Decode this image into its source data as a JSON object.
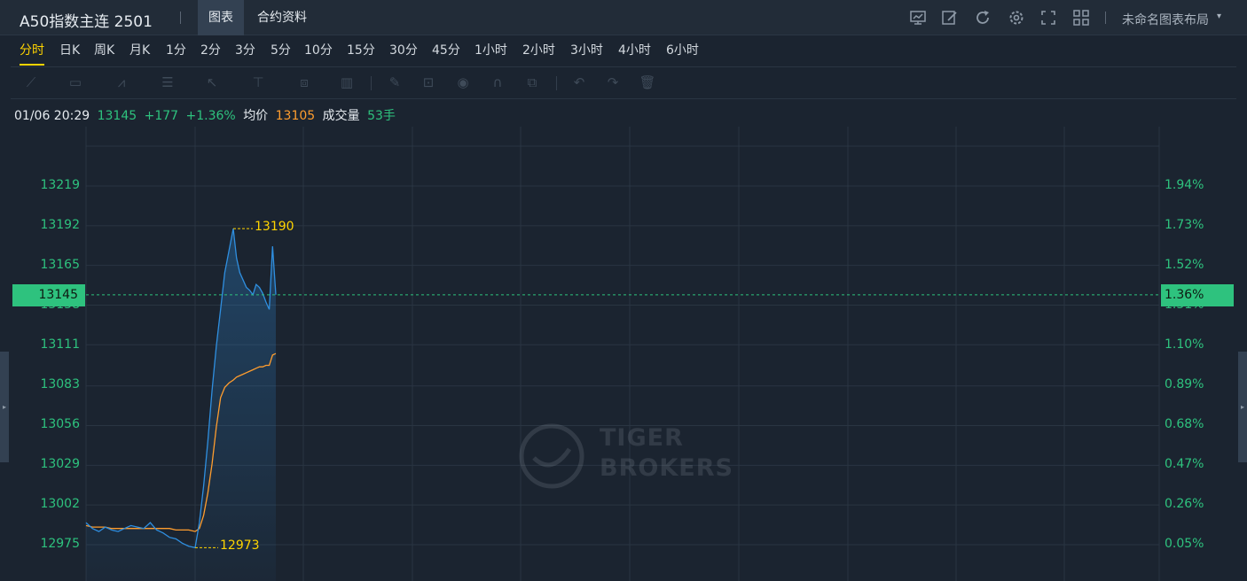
{
  "header": {
    "title": "A50指数主连 2501",
    "tabs": [
      {
        "label": "图表",
        "active": true
      },
      {
        "label": "合约资料",
        "active": false
      }
    ],
    "icons": [
      "chart-template-icon",
      "draw-icon",
      "refresh-icon",
      "settings-icon",
      "fullscreen-icon",
      "layout-grid-icon"
    ],
    "layout_label": "未命名图表布局"
  },
  "periods": [
    "分时",
    "日K",
    "周K",
    "月K",
    "1分",
    "2分",
    "3分",
    "5分",
    "10分",
    "15分",
    "30分",
    "45分",
    "1小时",
    "2小时",
    "3小时",
    "4小时",
    "6小时"
  ],
  "active_period": "分时",
  "drawing_tools": [
    "line-tool-icon",
    "rectangle-tool-icon",
    "pattern-tool-icon",
    "fibonacci-tool-icon",
    "arrow-tool-icon",
    "text-tool-icon",
    "measure-tool-icon",
    "volume-tool-icon",
    "pencil-icon",
    "lock-icon",
    "eye-icon",
    "magnet-icon",
    "clone-icon",
    "undo-icon",
    "redo-icon",
    "trash-icon"
  ],
  "info": {
    "datetime": "01/06 20:29",
    "price": "13145",
    "change": "+177",
    "change_pct": "+1.36%",
    "avg_label": "均价",
    "avg_value": "13105",
    "volume_label": "成交量",
    "volume_value": "53手"
  },
  "chart": {
    "y_left_ticks": [
      "13219",
      "13192",
      "13165",
      "13138",
      "13111",
      "13083",
      "13056",
      "13029",
      "13002",
      "12975"
    ],
    "y_right_ticks": [
      "1.94%",
      "1.73%",
      "1.52%",
      "1.31%",
      "1.10%",
      "0.89%",
      "0.68%",
      "0.47%",
      "0.26%",
      "0.05%"
    ],
    "current_price_label": "13145",
    "current_pct_label": "1.36%",
    "high_annotation": "13190",
    "low_annotation": "12973",
    "watermark_line1": "TIGER",
    "watermark_line2": "BROKERS",
    "colors": {
      "price_line": "#2f8fe0",
      "avg_line": "#ff9d2e",
      "up": "#2ec27e",
      "grid": "#2a3542",
      "accent": "#ffd400"
    }
  },
  "chart_data": {
    "type": "line",
    "series": [
      {
        "name": "",
        "values": [
          12990,
          12986,
          12984,
          12987,
          12985,
          12984,
          12986,
          12988,
          12987,
          12986,
          12990,
          12985,
          12983,
          12980,
          12979,
          12976,
          12974,
          12973,
          12990,
          13015,
          13045,
          13080,
          13110,
          13135,
          13160,
          13175,
          13190,
          13170,
          13160,
          13155,
          13150,
          13148,
          13145,
          13152,
          13150,
          13146,
          13140,
          13135,
          13178,
          13145
        ]
      },
      {
        "name": "均价",
        "values": [
          12988,
          12987,
          12987,
          12987,
          12986,
          12986,
          12986,
          12986,
          12986,
          12986,
          12986,
          12986,
          12986,
          12986,
          12985,
          12985,
          12985,
          12984,
          12986,
          12995,
          13010,
          13030,
          13055,
          13075,
          13082,
          13085,
          13087,
          13089,
          13090,
          13091,
          13092,
          13093,
          13094,
          13095,
          13096,
          13096,
          13097,
          13097,
          13104,
          13105
        ]
      }
    ],
    "ylim": [
      12968,
      13236
    ],
    "y_ticks": [
      12975,
      13002,
      13029,
      13056,
      13083,
      13111,
      13138,
      13165,
      13192,
      13219
    ],
    "high": 13190,
    "low": 12973,
    "last": 13145,
    "grid": true
  }
}
